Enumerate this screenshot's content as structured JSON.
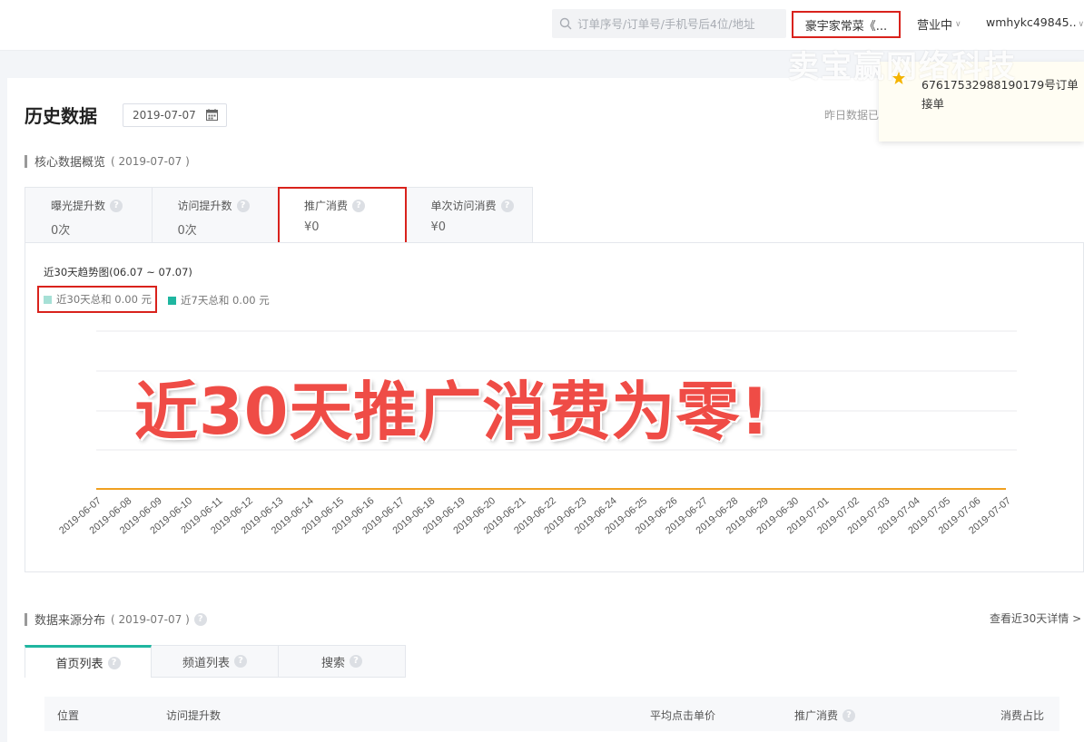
{
  "header": {
    "search_placeholder": "订单序号/订单号/手机号后4位/地址",
    "shop_name": "豪宇家常菜《...",
    "status_label": "营业中",
    "account_name": "wmhykc49845..",
    "watermark": "卖宝赢网络科技"
  },
  "notification": {
    "title": "67617532988190179号订单",
    "subtitle": "接单"
  },
  "page": {
    "title": "历史数据",
    "date": "2019-07-07",
    "yesterday_label": "昨日数据已"
  },
  "core": {
    "title": "核心数据概览",
    "date": "( 2019-07-07 )",
    "metrics": [
      {
        "name": "曝光提升数",
        "value": "0次"
      },
      {
        "name": "访问提升数",
        "value": "0次"
      },
      {
        "name": "推广消费",
        "value": "¥0"
      },
      {
        "name": "单次访问消费",
        "value": "¥0"
      }
    ]
  },
  "chart_data": {
    "type": "line",
    "title": "近30天趋势图(06.07 ~ 07.07)",
    "legend": [
      "近30天总和 0.00 元",
      "近7天总和 0.00 元"
    ],
    "series_colors": [
      "#a6e0d6",
      "#1fb6a0"
    ],
    "x": [
      "2019-06-07",
      "2019-06-08",
      "2019-06-09",
      "2019-06-10",
      "2019-06-11",
      "2019-06-12",
      "2019-06-13",
      "2019-06-14",
      "2019-06-15",
      "2019-06-16",
      "2019-06-17",
      "2019-06-18",
      "2019-06-19",
      "2019-06-20",
      "2019-06-21",
      "2019-06-22",
      "2019-06-23",
      "2019-06-24",
      "2019-06-25",
      "2019-06-26",
      "2019-06-27",
      "2019-06-28",
      "2019-06-29",
      "2019-06-30",
      "2019-07-01",
      "2019-07-02",
      "2019-07-03",
      "2019-07-04",
      "2019-07-05",
      "2019-07-06",
      "2019-07-07"
    ],
    "series": [
      {
        "values": [
          0,
          0,
          0,
          0,
          0,
          0,
          0,
          0,
          0,
          0,
          0,
          0,
          0,
          0,
          0,
          0,
          0,
          0,
          0,
          0,
          0,
          0,
          0,
          0,
          0,
          0,
          0,
          0,
          0,
          0,
          0
        ]
      }
    ],
    "line_color": "#f0a020",
    "grid": true
  },
  "overlay_text": "近30天推广消费为零!",
  "source": {
    "title": "数据来源分布",
    "date": "( 2019-07-07 )",
    "view_link": "查看近30天详情 >",
    "tabs": [
      "首页列表",
      "频道列表",
      "搜索"
    ],
    "columns": [
      "位置",
      "访问提升数",
      "平均点击单价",
      "推广消费",
      "消费占比"
    ]
  }
}
